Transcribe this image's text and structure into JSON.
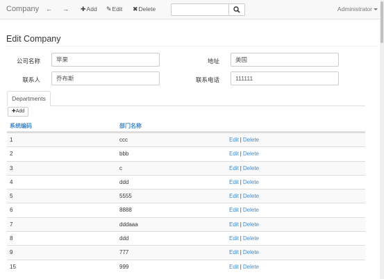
{
  "navbar": {
    "brand": "Company",
    "add_label": "Add",
    "edit_label": "Edit",
    "delete_label": "Delete",
    "search_value": "",
    "user_label": "Administrator"
  },
  "page": {
    "title": "Edit Company"
  },
  "form": {
    "name_label": "公司名称",
    "name_value": "苹果",
    "address_label": "地址",
    "address_value": "美国",
    "contact_label": "联系人",
    "contact_value": "乔布斯",
    "phone_label": "联系电话",
    "phone_value": "111111"
  },
  "tabs": {
    "departments": "Departments"
  },
  "departments": {
    "add_label": "Add",
    "columns": [
      "系统编码",
      "部门名称"
    ],
    "edit_label": "Edit",
    "delete_label": "Delete",
    "rows": [
      {
        "code": "1",
        "name": "ccc"
      },
      {
        "code": "2",
        "name": "bbb"
      },
      {
        "code": "3",
        "name": "c"
      },
      {
        "code": "4",
        "name": "ddd"
      },
      {
        "code": "5",
        "name": "5555"
      },
      {
        "code": "6",
        "name": "8888"
      },
      {
        "code": "7",
        "name": "dddaaa"
      },
      {
        "code": "8",
        "name": "ddd"
      },
      {
        "code": "9",
        "name": "777"
      },
      {
        "code": "15",
        "name": "999"
      }
    ]
  }
}
